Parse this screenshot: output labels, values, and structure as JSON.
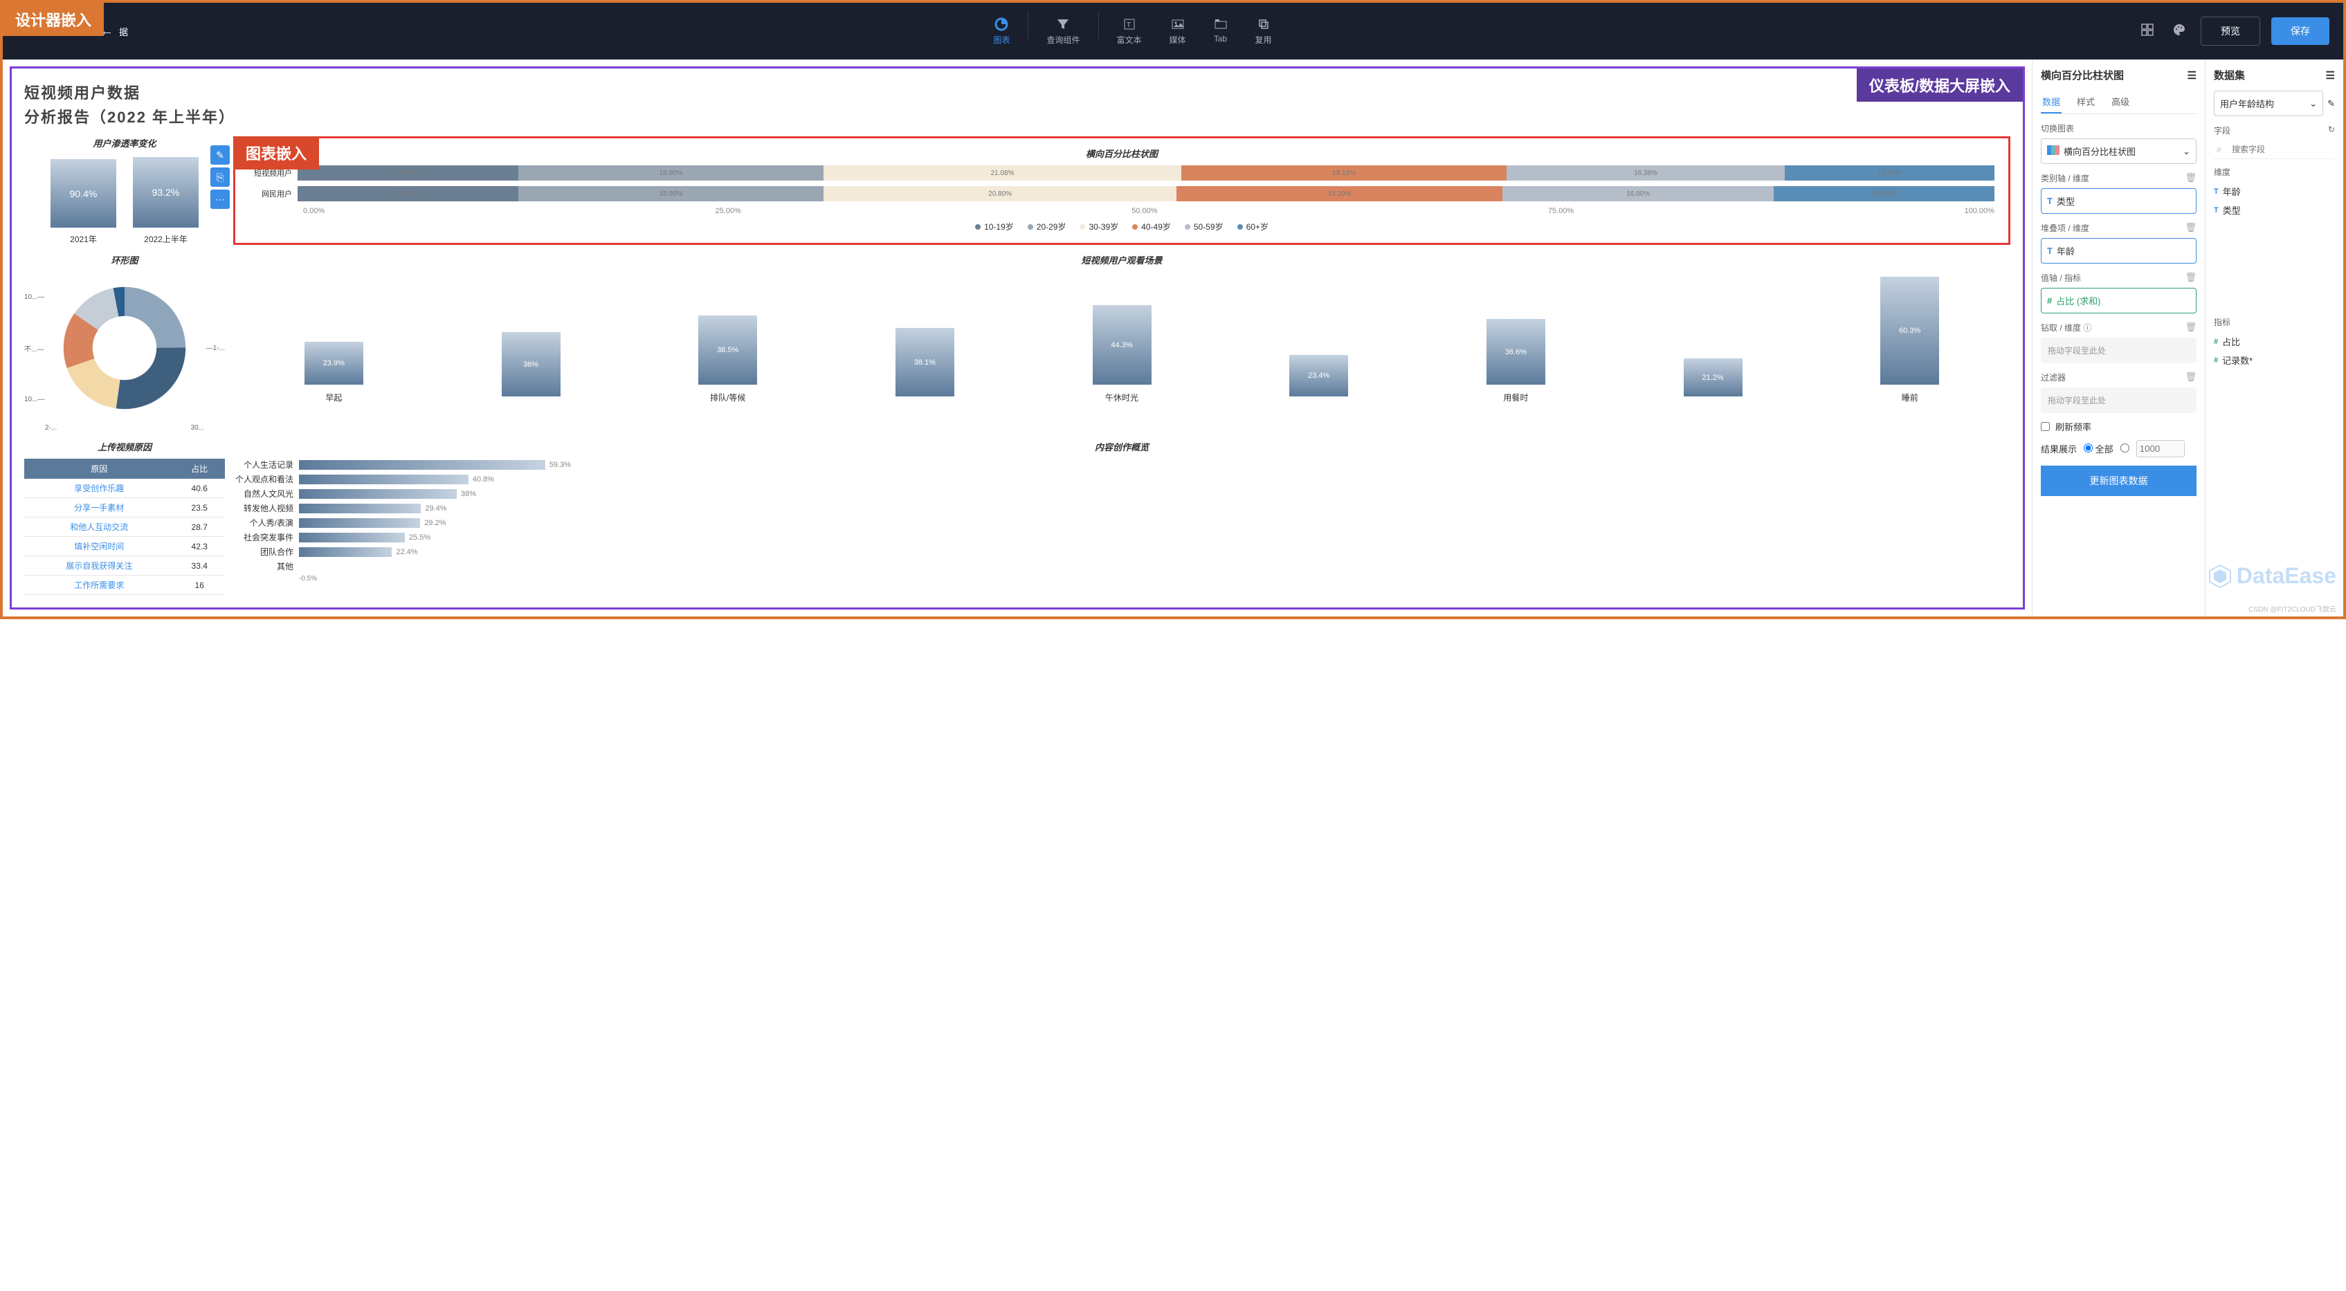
{
  "annotations": {
    "designer": "设计器嵌入",
    "dashboard": "仪表板/数据大屏嵌入",
    "chart": "图表嵌入"
  },
  "topbar": {
    "breadcrumb_suffix": "据",
    "menu": [
      {
        "label": "图表",
        "icon": "chart-pie-icon",
        "active": true
      },
      {
        "label": "查询组件",
        "icon": "filter-icon"
      },
      {
        "label": "富文本",
        "icon": "text-icon"
      },
      {
        "label": "媒体",
        "icon": "image-icon"
      },
      {
        "label": "Tab",
        "icon": "tab-icon"
      },
      {
        "label": "复用",
        "icon": "copy-icon"
      }
    ],
    "preview": "预览",
    "save": "保存"
  },
  "dashboard": {
    "title_line1": "短视频用户数据",
    "title_line2": "分析报告（2022 年上半年）",
    "penetration": {
      "title": "用户渗透率变化",
      "bars": [
        {
          "label": "2021年",
          "value": 90.4,
          "text": "90.4%"
        },
        {
          "label": "2022上半年",
          "value": 93.2,
          "text": "93.2%"
        }
      ]
    },
    "donut": {
      "title": "环形图",
      "left_labels": [
        "10...",
        "不...",
        "10..."
      ],
      "right_labels": [
        "1-..."
      ],
      "bottom_labels": [
        "2-...",
        "30..."
      ]
    },
    "scenes": {
      "title": "短视频用户观看场景",
      "bars": [
        {
          "label": "早起",
          "value": 23.9,
          "text": "23.9%"
        },
        {
          "label": "",
          "value": 36,
          "text": "36%"
        },
        {
          "label": "排队/等候",
          "value": 38.5,
          "text": "38.5%"
        },
        {
          "label": "",
          "value": 38.1,
          "text": "38.1%"
        },
        {
          "label": "午休时光",
          "value": 44.3,
          "text": "44.3%"
        },
        {
          "label": "",
          "value": 23.4,
          "text": "23.4%"
        },
        {
          "label": "用餐时",
          "value": 36.6,
          "text": "36.6%"
        },
        {
          "label": "",
          "value": 21.2,
          "text": "21.2%"
        },
        {
          "label": "睡前",
          "value": 60.3,
          "text": "60.3%"
        }
      ]
    },
    "upload_table": {
      "title": "上传视频原因",
      "headers": [
        "原因",
        "占比"
      ],
      "rows": [
        [
          "享受创作乐趣",
          "40.6"
        ],
        [
          "分享一手素材",
          "23.5"
        ],
        [
          "和他人互动交流",
          "28.7"
        ],
        [
          "填补空闲时间",
          "42.3"
        ],
        [
          "展示自我获得关注",
          "33.4"
        ],
        [
          "工作所需要求",
          "16"
        ]
      ]
    },
    "content_overview": {
      "title": "内容创作概览",
      "rows": [
        {
          "label": "个人生活记录",
          "value": 59.3,
          "text": "59.3%"
        },
        {
          "label": "个人观点和看法",
          "value": 40.8,
          "text": "40.8%"
        },
        {
          "label": "自然人文风光",
          "value": 38,
          "text": "38%"
        },
        {
          "label": "转发他人视频",
          "value": 29.4,
          "text": "29.4%"
        },
        {
          "label": "个人秀/表演",
          "value": 29.2,
          "text": "29.2%"
        },
        {
          "label": "社会突发事件",
          "value": 25.5,
          "text": "25.5%"
        },
        {
          "label": "团队合作",
          "value": 22.4,
          "text": "22.4%"
        },
        {
          "label": "其他",
          "value": 0,
          "text": ""
        }
      ],
      "axis_min": "-0.5%"
    }
  },
  "chart_data": {
    "type": "bar",
    "title": "横向百分比柱状图",
    "orientation": "horizontal-stacked-100",
    "categories": [
      "短视频用户",
      "网民用户"
    ],
    "stack_dimension": "年龄",
    "series": [
      {
        "name": "10-19岁",
        "color": "#6b7f93",
        "values": [
          13.0,
          13.0
        ]
      },
      {
        "name": "20-29岁",
        "color": "#9aa6b2",
        "values": [
          18.0,
          18.0
        ]
      },
      {
        "name": "30-39岁",
        "color": "#f3ead9",
        "values": [
          21.08,
          20.8
        ]
      },
      {
        "name": "40-49岁",
        "color": "#d9845f",
        "values": [
          19.18,
          19.2
        ]
      },
      {
        "name": "50-59岁",
        "color": "#b5bec8",
        "values": [
          16.38,
          16.0
        ]
      },
      {
        "name": "60+岁",
        "color": "#5a8db5",
        "values": [
          12.36,
          13.0
        ]
      }
    ],
    "x_ticks": [
      "0.00%",
      "25.00%",
      "50.00%",
      "75.00%",
      "100.00%"
    ],
    "xlabel": "",
    "ylabel": "",
    "xlim": [
      0,
      100
    ]
  },
  "config_panel": {
    "title": "横向百分比柱状图",
    "tabs": [
      "数据",
      "样式",
      "高级"
    ],
    "active_tab": "数据",
    "switch_chart_label": "切换图表",
    "chart_type_value": "横向百分比柱状图",
    "category_label": "类别轴 / 维度",
    "category_field": "类型",
    "stack_label": "堆叠项 / 维度",
    "stack_field": "年龄",
    "value_label": "值轴 / 指标",
    "value_field": "占比 (求和)",
    "drill_label": "钻取 / 维度",
    "drill_placeholder": "拖动字段至此处",
    "filter_label": "过滤器",
    "filter_placeholder": "拖动字段至此处",
    "refresh_label": "刷新频率",
    "result_label": "结果展示",
    "result_all": "全部",
    "result_num": "1000",
    "update_btn": "更新图表数据",
    "info_icon": "ⓘ"
  },
  "dataset_panel": {
    "title": "数据集",
    "selected": "用户年龄结构",
    "field_label": "字段",
    "search_placeholder": "搜索字段",
    "dim_label": "维度",
    "dims": [
      "年龄",
      "类型"
    ],
    "metric_label": "指标",
    "metrics": [
      "占比",
      "记录数*"
    ]
  },
  "watermark": "DataEase",
  "footer": "CSDN @FIT2CLOUD飞致云"
}
